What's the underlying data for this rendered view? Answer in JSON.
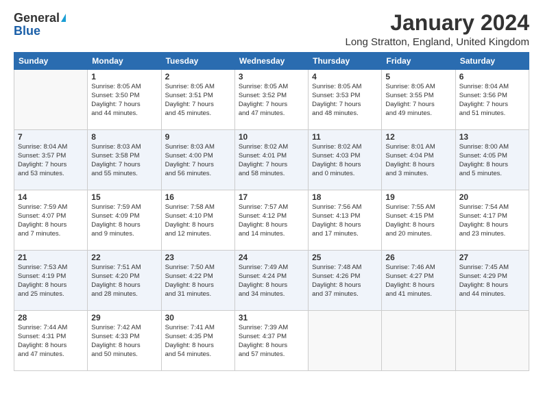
{
  "logo": {
    "general": "General",
    "blue": "Blue"
  },
  "header": {
    "month": "January 2024",
    "location": "Long Stratton, England, United Kingdom"
  },
  "weekdays": [
    "Sunday",
    "Monday",
    "Tuesday",
    "Wednesday",
    "Thursday",
    "Friday",
    "Saturday"
  ],
  "weeks": [
    [
      {
        "day": "",
        "info": ""
      },
      {
        "day": "1",
        "info": "Sunrise: 8:05 AM\nSunset: 3:50 PM\nDaylight: 7 hours\nand 44 minutes."
      },
      {
        "day": "2",
        "info": "Sunrise: 8:05 AM\nSunset: 3:51 PM\nDaylight: 7 hours\nand 45 minutes."
      },
      {
        "day": "3",
        "info": "Sunrise: 8:05 AM\nSunset: 3:52 PM\nDaylight: 7 hours\nand 47 minutes."
      },
      {
        "day": "4",
        "info": "Sunrise: 8:05 AM\nSunset: 3:53 PM\nDaylight: 7 hours\nand 48 minutes."
      },
      {
        "day": "5",
        "info": "Sunrise: 8:05 AM\nSunset: 3:55 PM\nDaylight: 7 hours\nand 49 minutes."
      },
      {
        "day": "6",
        "info": "Sunrise: 8:04 AM\nSunset: 3:56 PM\nDaylight: 7 hours\nand 51 minutes."
      }
    ],
    [
      {
        "day": "7",
        "info": "Sunrise: 8:04 AM\nSunset: 3:57 PM\nDaylight: 7 hours\nand 53 minutes."
      },
      {
        "day": "8",
        "info": "Sunrise: 8:03 AM\nSunset: 3:58 PM\nDaylight: 7 hours\nand 55 minutes."
      },
      {
        "day": "9",
        "info": "Sunrise: 8:03 AM\nSunset: 4:00 PM\nDaylight: 7 hours\nand 56 minutes."
      },
      {
        "day": "10",
        "info": "Sunrise: 8:02 AM\nSunset: 4:01 PM\nDaylight: 7 hours\nand 58 minutes."
      },
      {
        "day": "11",
        "info": "Sunrise: 8:02 AM\nSunset: 4:03 PM\nDaylight: 8 hours\nand 0 minutes."
      },
      {
        "day": "12",
        "info": "Sunrise: 8:01 AM\nSunset: 4:04 PM\nDaylight: 8 hours\nand 3 minutes."
      },
      {
        "day": "13",
        "info": "Sunrise: 8:00 AM\nSunset: 4:05 PM\nDaylight: 8 hours\nand 5 minutes."
      }
    ],
    [
      {
        "day": "14",
        "info": "Sunrise: 7:59 AM\nSunset: 4:07 PM\nDaylight: 8 hours\nand 7 minutes."
      },
      {
        "day": "15",
        "info": "Sunrise: 7:59 AM\nSunset: 4:09 PM\nDaylight: 8 hours\nand 9 minutes."
      },
      {
        "day": "16",
        "info": "Sunrise: 7:58 AM\nSunset: 4:10 PM\nDaylight: 8 hours\nand 12 minutes."
      },
      {
        "day": "17",
        "info": "Sunrise: 7:57 AM\nSunset: 4:12 PM\nDaylight: 8 hours\nand 14 minutes."
      },
      {
        "day": "18",
        "info": "Sunrise: 7:56 AM\nSunset: 4:13 PM\nDaylight: 8 hours\nand 17 minutes."
      },
      {
        "day": "19",
        "info": "Sunrise: 7:55 AM\nSunset: 4:15 PM\nDaylight: 8 hours\nand 20 minutes."
      },
      {
        "day": "20",
        "info": "Sunrise: 7:54 AM\nSunset: 4:17 PM\nDaylight: 8 hours\nand 23 minutes."
      }
    ],
    [
      {
        "day": "21",
        "info": "Sunrise: 7:53 AM\nSunset: 4:19 PM\nDaylight: 8 hours\nand 25 minutes."
      },
      {
        "day": "22",
        "info": "Sunrise: 7:51 AM\nSunset: 4:20 PM\nDaylight: 8 hours\nand 28 minutes."
      },
      {
        "day": "23",
        "info": "Sunrise: 7:50 AM\nSunset: 4:22 PM\nDaylight: 8 hours\nand 31 minutes."
      },
      {
        "day": "24",
        "info": "Sunrise: 7:49 AM\nSunset: 4:24 PM\nDaylight: 8 hours\nand 34 minutes."
      },
      {
        "day": "25",
        "info": "Sunrise: 7:48 AM\nSunset: 4:26 PM\nDaylight: 8 hours\nand 37 minutes."
      },
      {
        "day": "26",
        "info": "Sunrise: 7:46 AM\nSunset: 4:27 PM\nDaylight: 8 hours\nand 41 minutes."
      },
      {
        "day": "27",
        "info": "Sunrise: 7:45 AM\nSunset: 4:29 PM\nDaylight: 8 hours\nand 44 minutes."
      }
    ],
    [
      {
        "day": "28",
        "info": "Sunrise: 7:44 AM\nSunset: 4:31 PM\nDaylight: 8 hours\nand 47 minutes."
      },
      {
        "day": "29",
        "info": "Sunrise: 7:42 AM\nSunset: 4:33 PM\nDaylight: 8 hours\nand 50 minutes."
      },
      {
        "day": "30",
        "info": "Sunrise: 7:41 AM\nSunset: 4:35 PM\nDaylight: 8 hours\nand 54 minutes."
      },
      {
        "day": "31",
        "info": "Sunrise: 7:39 AM\nSunset: 4:37 PM\nDaylight: 8 hours\nand 57 minutes."
      },
      {
        "day": "",
        "info": ""
      },
      {
        "day": "",
        "info": ""
      },
      {
        "day": "",
        "info": ""
      }
    ]
  ]
}
